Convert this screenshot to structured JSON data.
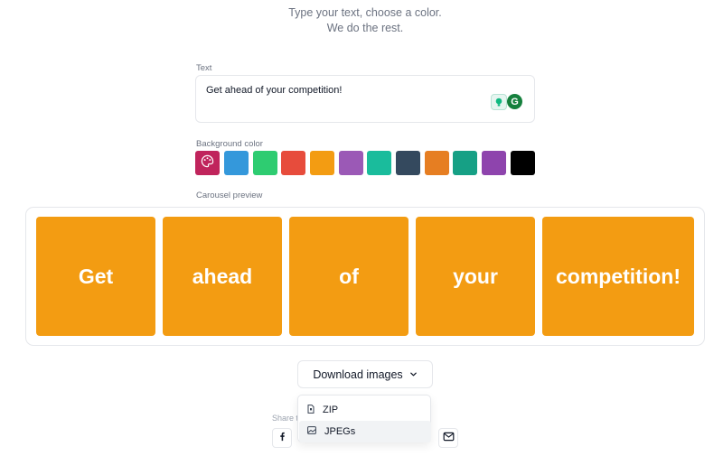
{
  "tagline": {
    "line1": "Type your text, choose a color.",
    "line2": "We do the rest."
  },
  "text_field": {
    "label": "Text",
    "value": "Get ahead of your competition!"
  },
  "background": {
    "label": "Background color",
    "custom_color": "#c0245c",
    "swatches": [
      "#3498db",
      "#2ecc71",
      "#e74c3c",
      "#f39c12",
      "#9b59b6",
      "#1abc9c",
      "#34495e",
      "#e67e22",
      "#16a085",
      "#8e44ad",
      "#000000"
    ]
  },
  "preview": {
    "label": "Carousel preview",
    "slide_color": "#f39c12",
    "slides": [
      "Get",
      "ahead",
      "of",
      "your",
      "competition!"
    ]
  },
  "download": {
    "button_label": "Download images",
    "options": [
      "ZIP",
      "JPEGs"
    ]
  },
  "share": {
    "label": "Share t"
  }
}
